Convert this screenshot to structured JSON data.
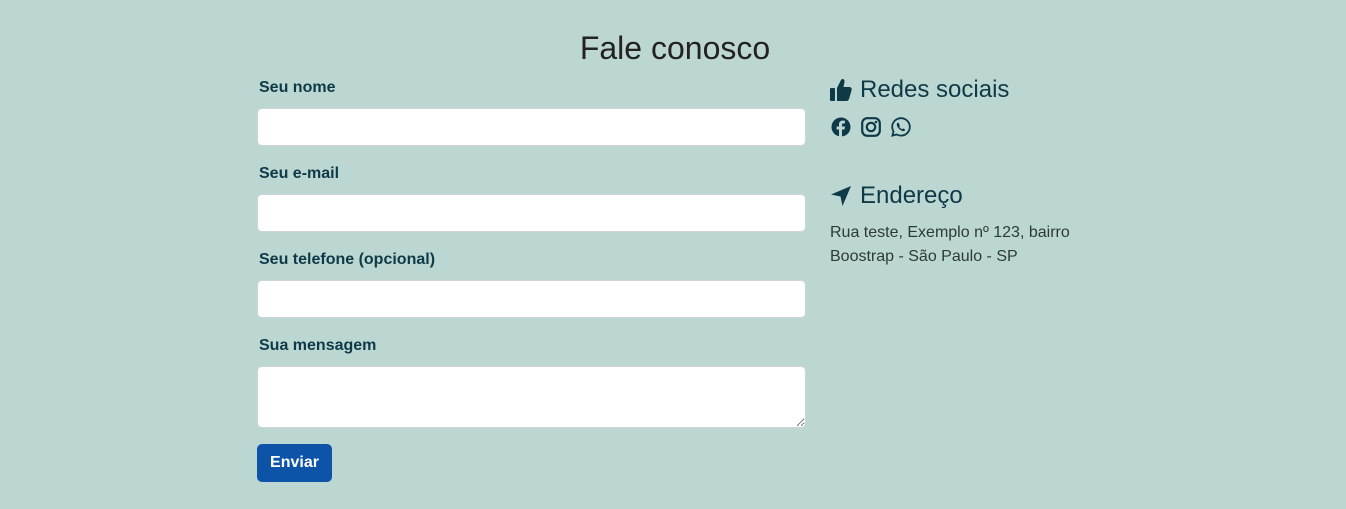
{
  "page": {
    "title": "Fale conosco"
  },
  "form": {
    "name_label": "Seu nome",
    "email_label": "Seu e-mail",
    "phone_label": "Seu telefone (opcional)",
    "message_label": "Sua mensagem",
    "name_value": "",
    "email_value": "",
    "phone_value": "",
    "message_value": "",
    "submit_label": "Enviar"
  },
  "social": {
    "title": "Redes sociais",
    "icon": "thumbs-up-icon",
    "links": [
      {
        "icon": "facebook-icon"
      },
      {
        "icon": "instagram-icon"
      },
      {
        "icon": "whatsapp-icon"
      }
    ]
  },
  "address": {
    "title": "Endereço",
    "icon": "location-arrow-icon",
    "text": "Rua teste, Exemplo nº 123, bairro Boostrap - São Paulo - SP"
  },
  "colors": {
    "background": "#bcd6d2",
    "label_text": "#0e3a48",
    "button": "#0d53a8",
    "button_text": "#ffffff"
  }
}
